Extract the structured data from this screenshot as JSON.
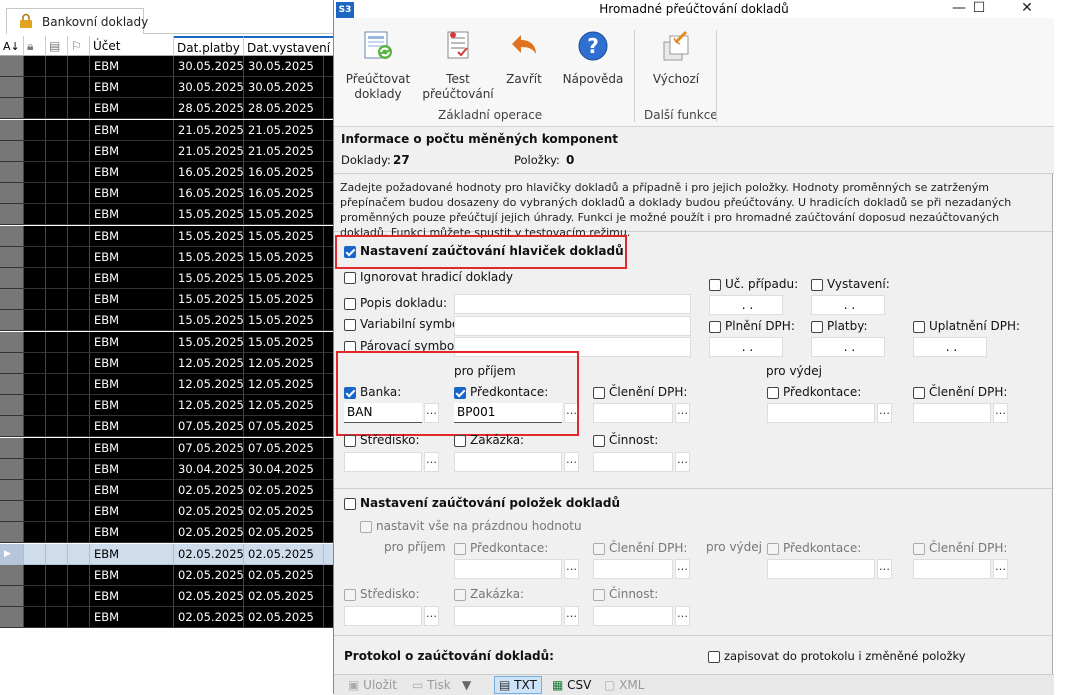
{
  "background_app": {
    "tab_label": "Bankovní doklady",
    "columns": [
      "Účet",
      "Dat.platby",
      "Dat.vystavení"
    ],
    "rows": [
      {
        "ucet": "EBM",
        "platby": "30.05.2025",
        "vystaveni": "30.05.2025"
      },
      {
        "ucet": "EBM",
        "platby": "30.05.2025",
        "vystaveni": "30.05.2025"
      },
      {
        "ucet": "EBM",
        "platby": "28.05.2025",
        "vystaveni": "28.05.2025"
      },
      {
        "ucet": "EBM",
        "platby": "21.05.2025",
        "vystaveni": "21.05.2025"
      },
      {
        "ucet": "EBM",
        "platby": "21.05.2025",
        "vystaveni": "21.05.2025"
      },
      {
        "ucet": "EBM",
        "platby": "16.05.2025",
        "vystaveni": "16.05.2025"
      },
      {
        "ucet": "EBM",
        "platby": "16.05.2025",
        "vystaveni": "16.05.2025"
      },
      {
        "ucet": "EBM",
        "platby": "15.05.2025",
        "vystaveni": "15.05.2025"
      },
      {
        "ucet": "EBM",
        "platby": "15.05.2025",
        "vystaveni": "15.05.2025"
      },
      {
        "ucet": "EBM",
        "platby": "15.05.2025",
        "vystaveni": "15.05.2025"
      },
      {
        "ucet": "EBM",
        "platby": "15.05.2025",
        "vystaveni": "15.05.2025"
      },
      {
        "ucet": "EBM",
        "platby": "15.05.2025",
        "vystaveni": "15.05.2025"
      },
      {
        "ucet": "EBM",
        "platby": "15.05.2025",
        "vystaveni": "15.05.2025"
      },
      {
        "ucet": "EBM",
        "platby": "15.05.2025",
        "vystaveni": "15.05.2025"
      },
      {
        "ucet": "EBM",
        "platby": "12.05.2025",
        "vystaveni": "12.05.2025"
      },
      {
        "ucet": "EBM",
        "platby": "12.05.2025",
        "vystaveni": "12.05.2025"
      },
      {
        "ucet": "EBM",
        "platby": "12.05.2025",
        "vystaveni": "12.05.2025"
      },
      {
        "ucet": "EBM",
        "platby": "07.05.2025",
        "vystaveni": "07.05.2025"
      },
      {
        "ucet": "EBM",
        "platby": "07.05.2025",
        "vystaveni": "07.05.2025"
      },
      {
        "ucet": "EBM",
        "platby": "30.04.2025",
        "vystaveni": "30.04.2025"
      },
      {
        "ucet": "EBM",
        "platby": "02.05.2025",
        "vystaveni": "02.05.2025"
      },
      {
        "ucet": "EBM",
        "platby": "02.05.2025",
        "vystaveni": "02.05.2025"
      },
      {
        "ucet": "EBM",
        "platby": "02.05.2025",
        "vystaveni": "02.05.2025"
      },
      {
        "ucet": "EBM",
        "platby": "02.05.2025",
        "vystaveni": "02.05.2025",
        "selected": true
      },
      {
        "ucet": "EBM",
        "platby": "02.05.2025",
        "vystaveni": "02.05.2025"
      },
      {
        "ucet": "EBM",
        "platby": "02.05.2025",
        "vystaveni": "02.05.2025"
      },
      {
        "ucet": "EBM",
        "platby": "02.05.2025",
        "vystaveni": "02.05.2025"
      }
    ]
  },
  "dialog": {
    "app_icon": "S3",
    "title": "Hromadné přeúčtování dokladů",
    "window_controls": {
      "minimize": "—",
      "maximize": "☐",
      "close": "✕"
    },
    "ribbon": {
      "buttons": [
        {
          "label": "Přeúčtovat doklady",
          "icon": "recalculate-icon"
        },
        {
          "label": "Test přeúčtování",
          "icon": "test-icon"
        },
        {
          "label": "Zavřít",
          "icon": "undo-arrow-icon"
        },
        {
          "label": "Nápověda",
          "icon": "help-icon"
        },
        {
          "label": "Výchozí",
          "icon": "default-icon"
        }
      ],
      "groups": [
        "Základní operace",
        "Další funkce"
      ]
    },
    "info": {
      "heading": "Informace o počtu měněných komponent",
      "doklady_label": "Doklady:",
      "doklady_value": "27",
      "polozky_label": "Položky:",
      "polozky_value": "0"
    },
    "description": "Zadejte požadované hodnoty pro hlavičky dokladů a případně i pro jejich položky. Hodnoty proměnných se zatrženým přepínačem budou dosazeny do vybraných dokladů a doklady budou přeúčtovány. U hradicích dokladů se při nezadaných proměnných pouze přeúčtují jejich úhrady. Funkci je možné použít i pro hromadné zaúčtování doposud nezaúčtovaných dokladů. Funkci můžete spustit v testovacím režimu.",
    "header_section": {
      "title": "Nastavení zaúčtování hlaviček dokladů",
      "ignore_label": "Ignorovat hradicí doklady",
      "popis_label": "Popis dokladu:",
      "varsym_label": "Variabilní symbol:",
      "parsym_label": "Párovací symbol:",
      "uc_pripadu_label": "Uč. případu:",
      "vystaveni_label": "Vystavení:",
      "plneni_label": "Plnění DPH:",
      "platby_label": "Platby:",
      "uplatneni_label": "Uplatnění DPH:",
      "date_placeholder": ". .",
      "pro_prijem": "pro příjem",
      "pro_vydej": "pro výdej",
      "banka_label": "Banka:",
      "banka_value": "BAN",
      "predkontace_label": "Předkontace:",
      "predkontace_value": "BP001",
      "cleneni_label": "Členění DPH:",
      "stredisko_label": "Středisko:",
      "zakazka_label": "Zakázka:",
      "cinnost_label": "Činnost:",
      "dots": "…"
    },
    "items_section": {
      "title": "Nastavení zaúčtování položek dokladů",
      "empty_label": "nastavit vše na prázdnou hodnotu",
      "pro_prijem": "pro příjem",
      "pro_vydej": "pro výdej",
      "predkontace_label": "Předkontace:",
      "cleneni_label": "Členění DPH:",
      "stredisko_label": "Středisko:",
      "zakazka_label": "Zakázka:",
      "cinnost_label": "Činnost:"
    },
    "protocol": {
      "title": "Protokol o zaúčtování dokladů:",
      "checkbox_label": "zapisovat do protokolu i změněné položky"
    },
    "footer": {
      "ulozit": "Uložit",
      "tisk": "Tisk",
      "txt": "TXT",
      "csv": "CSV",
      "xml": "XML"
    },
    "colors": {
      "accent": "#1766c8",
      "highlight": "#e0282d"
    }
  }
}
